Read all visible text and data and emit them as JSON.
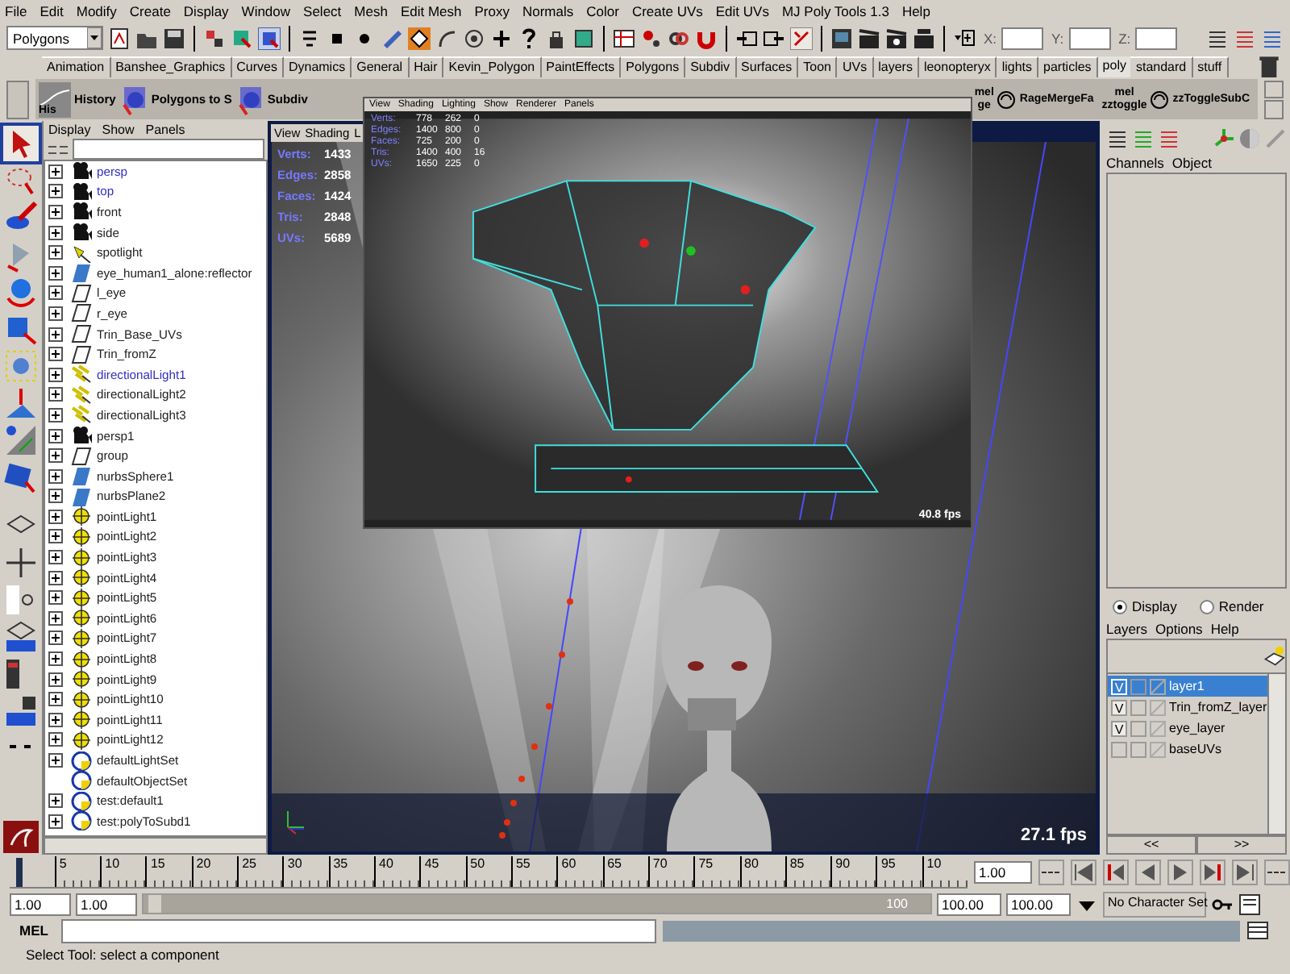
{
  "menu_bar": [
    "File",
    "Edit",
    "Modify",
    "Create",
    "Display",
    "Window",
    "Select",
    "Mesh",
    "Edit Mesh",
    "Proxy",
    "Normals",
    "Color",
    "Create UVs",
    "Edit UVs",
    "MJ Poly Tools 1.3",
    "Help"
  ],
  "toolbar": {
    "mode": "Polygons",
    "coords": [
      {
        "label": "X:"
      },
      {
        "label": "Y:"
      },
      {
        "label": "Z:"
      }
    ]
  },
  "shelf_tabs": [
    {
      "label": "Animation",
      "selected": false
    },
    {
      "label": "Banshee_Graphics",
      "selected": false
    },
    {
      "label": "Curves",
      "selected": false
    },
    {
      "label": "Dynamics",
      "selected": false
    },
    {
      "label": "General",
      "selected": false
    },
    {
      "label": "Hair",
      "selected": false
    },
    {
      "label": "Kevin_Polygon",
      "selected": false
    },
    {
      "label": "PaintEffects",
      "selected": false
    },
    {
      "label": "Polygons",
      "selected": false
    },
    {
      "label": "Subdiv",
      "selected": false
    },
    {
      "label": "Surfaces",
      "selected": false
    },
    {
      "label": "Toon",
      "selected": false
    },
    {
      "label": "UVs",
      "selected": false
    },
    {
      "label": "layers",
      "selected": false
    },
    {
      "label": "leonopteryx",
      "selected": false
    },
    {
      "label": "lights",
      "selected": false
    },
    {
      "label": "particles",
      "selected": false
    },
    {
      "label": "poly",
      "selected": true
    },
    {
      "label": "standard",
      "selected": false
    },
    {
      "label": "stuff",
      "selected": false
    }
  ],
  "shelf": {
    "left_items": [
      {
        "icon_text": "His",
        "label": "History"
      },
      {
        "label": "Polygons to S"
      },
      {
        "label": "Subdiv"
      }
    ],
    "right_items": [
      {
        "icon_text": "mel",
        "caption": "ge",
        "label": "RageMergeFa"
      },
      {
        "icon_text": "mel",
        "caption": "zztoggle",
        "label": "zzToggleSubC"
      }
    ]
  },
  "outliner": {
    "menu": [
      "Display",
      "Show",
      "Panels"
    ],
    "items": [
      {
        "name": "persp",
        "kind": "camera",
        "highlighted": true,
        "expandable": true
      },
      {
        "name": "top",
        "kind": "camera",
        "highlighted": true,
        "expandable": true
      },
      {
        "name": "front",
        "kind": "camera",
        "highlighted": false,
        "expandable": true
      },
      {
        "name": "side",
        "kind": "camera",
        "highlighted": false,
        "expandable": true
      },
      {
        "name": "spotlight",
        "kind": "spotlight",
        "highlighted": false,
        "expandable": true
      },
      {
        "name": "eye_human1_alone:reflector",
        "kind": "nurbs",
        "highlighted": false,
        "expandable": true
      },
      {
        "name": "l_eye",
        "kind": "mesh",
        "highlighted": false,
        "expandable": true
      },
      {
        "name": "r_eye",
        "kind": "mesh",
        "highlighted": false,
        "expandable": true
      },
      {
        "name": "Trin_Base_UVs",
        "kind": "mesh",
        "highlighted": false,
        "expandable": true
      },
      {
        "name": "Trin_fromZ",
        "kind": "mesh",
        "highlighted": false,
        "expandable": true
      },
      {
        "name": "directionalLight1",
        "kind": "directional",
        "highlighted": true,
        "expandable": true
      },
      {
        "name": "directionalLight2",
        "kind": "directional",
        "highlighted": false,
        "expandable": true
      },
      {
        "name": "directionalLight3",
        "kind": "directional",
        "highlighted": false,
        "expandable": true
      },
      {
        "name": "persp1",
        "kind": "camera",
        "highlighted": false,
        "expandable": true
      },
      {
        "name": "group",
        "kind": "mesh",
        "highlighted": false,
        "expandable": true
      },
      {
        "name": "nurbsSphere1",
        "kind": "nurbs",
        "highlighted": false,
        "expandable": true
      },
      {
        "name": "nurbsPlane2",
        "kind": "nurbs",
        "highlighted": false,
        "expandable": true
      },
      {
        "name": "pointLight1",
        "kind": "point",
        "highlighted": false,
        "expandable": true
      },
      {
        "name": "pointLight2",
        "kind": "point",
        "highlighted": false,
        "expandable": true
      },
      {
        "name": "pointLight3",
        "kind": "point",
        "highlighted": false,
        "expandable": true
      },
      {
        "name": "pointLight4",
        "kind": "point",
        "highlighted": false,
        "expandable": true
      },
      {
        "name": "pointLight5",
        "kind": "point",
        "highlighted": false,
        "expandable": true
      },
      {
        "name": "pointLight6",
        "kind": "point",
        "highlighted": false,
        "expandable": true
      },
      {
        "name": "pointLight7",
        "kind": "point",
        "highlighted": false,
        "expandable": true
      },
      {
        "name": "pointLight8",
        "kind": "point",
        "highlighted": false,
        "expandable": true
      },
      {
        "name": "pointLight9",
        "kind": "point",
        "highlighted": false,
        "expandable": true
      },
      {
        "name": "pointLight10",
        "kind": "point",
        "highlighted": false,
        "expandable": true
      },
      {
        "name": "pointLight11",
        "kind": "point",
        "highlighted": false,
        "expandable": true
      },
      {
        "name": "pointLight12",
        "kind": "point",
        "highlighted": false,
        "expandable": true
      },
      {
        "name": "defaultLightSet",
        "kind": "set",
        "highlighted": false,
        "expandable": true
      },
      {
        "name": "defaultObjectSet",
        "kind": "set",
        "highlighted": false,
        "expandable": false
      },
      {
        "name": "test:default1",
        "kind": "set",
        "highlighted": false,
        "expandable": true
      },
      {
        "name": "test:polyToSubd1",
        "kind": "set",
        "highlighted": false,
        "expandable": true
      }
    ]
  },
  "viewport": {
    "menu": [
      "View",
      "Shading",
      "L"
    ],
    "stats": [
      {
        "label": "Verts:",
        "value": "1433"
      },
      {
        "label": "Edges:",
        "value": "2858"
      },
      {
        "label": "Faces:",
        "value": "1424"
      },
      {
        "label": "Tris:",
        "value": "2848"
      },
      {
        "label": "UVs:",
        "value": "5689"
      }
    ],
    "fps": "27.1 fps"
  },
  "inset_view": {
    "menu": [
      "View",
      "Shading",
      "Lighting",
      "Show",
      "Renderer",
      "Panels"
    ],
    "stats": [
      {
        "label": "Verts:",
        "values": [
          "778",
          "262",
          "0"
        ]
      },
      {
        "label": "Edges:",
        "values": [
          "1400",
          "800",
          "0"
        ]
      },
      {
        "label": "Faces:",
        "values": [
          "725",
          "200",
          "0"
        ]
      },
      {
        "label": "Tris:",
        "values": [
          "1400",
          "400",
          "16"
        ]
      },
      {
        "label": "UVs:",
        "values": [
          "1650",
          "225",
          "0"
        ]
      }
    ],
    "fps": "40.8 fps"
  },
  "channel_box": {
    "menu": [
      "Channels",
      "Object"
    ]
  },
  "layer_editor": {
    "modes": [
      {
        "label": "Display",
        "selected": true
      },
      {
        "label": "Render",
        "selected": false
      }
    ],
    "menu": [
      "Layers",
      "Options",
      "Help"
    ],
    "layers": [
      {
        "name": "layer1",
        "visible": true,
        "visible_mark": "V",
        "selected": true
      },
      {
        "name": "Trin_fromZ_layer",
        "visible": true,
        "visible_mark": "V",
        "selected": false
      },
      {
        "name": "eye_layer",
        "visible": true,
        "visible_mark": "V",
        "selected": false
      },
      {
        "name": "baseUVs",
        "visible": false,
        "selected": false
      }
    ],
    "scroll_buttons": [
      "<<",
      ">>"
    ]
  },
  "timeline": {
    "labels": [
      "5",
      "10",
      "15",
      "20",
      "25",
      "30",
      "35",
      "40",
      "45",
      "50",
      "55",
      "60",
      "65",
      "70",
      "75",
      "80",
      "85",
      "90",
      "95",
      "10"
    ],
    "level": 0,
    "current_frame": "1.00"
  },
  "range": {
    "level": 1,
    "start": "1.00",
    "playback_start": "1.00",
    "slider_end": "100",
    "playback_end": "100.00",
    "end": "100.00",
    "character_set": "No Character Set"
  },
  "command_line": {
    "label": "MEL"
  },
  "status": "Select Tool: select a component"
}
